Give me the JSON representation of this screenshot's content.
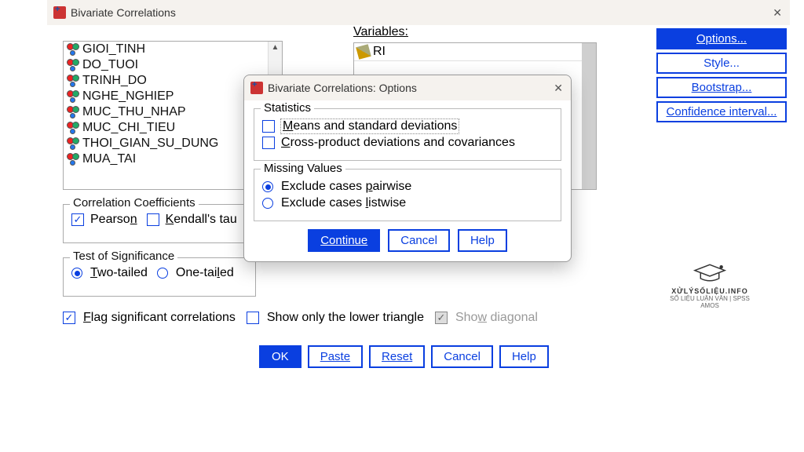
{
  "window": {
    "title": "Bivariate Correlations",
    "variables_label": "Variables:"
  },
  "left_vars": [
    "GIOI_TINH",
    "DO_TUOI",
    "TRINH_DO",
    "NGHE_NGHIEP",
    "MUC_THU_NHAP",
    "MUC_CHI_TIEU",
    "THOI_GIAN_SU_DUNG",
    "MUA_TAI"
  ],
  "selected_vars": [
    "RI"
  ],
  "side_buttons": {
    "options": "Options...",
    "style": "Style...",
    "bootstrap": "Bootstrap...",
    "confidence": "Confidence interval..."
  },
  "corr": {
    "group": "Correlation Coefficients",
    "pearson": "Pearson",
    "kendall": "Kendall's tau"
  },
  "sig": {
    "group": "Test of Significance",
    "two": "Two-tailed",
    "one": "One-tailed"
  },
  "flags": {
    "flag": "Flag significant correlations",
    "lower": "Show only the lower triangle",
    "diag": "Show diagonal"
  },
  "footer": {
    "ok": "OK",
    "paste": "Paste",
    "reset": "Reset",
    "cancel": "Cancel",
    "help": "Help"
  },
  "modal": {
    "title": "Bivariate Correlations: Options",
    "stats_group": "Statistics",
    "means": "Means and standard deviations",
    "cross": "Cross-product deviations and covariances",
    "missing_group": "Missing Values",
    "pairwise": "Exclude cases pairwise",
    "listwise": "Exclude cases listwise",
    "continue": "Continue",
    "cancel": "Cancel",
    "help": "Help"
  },
  "logo": {
    "line1": "XỬLÝSỐLIỆU.INFO",
    "line2": "SỐ LIỆU LUẬN VĂN | SPSS AMOS"
  }
}
